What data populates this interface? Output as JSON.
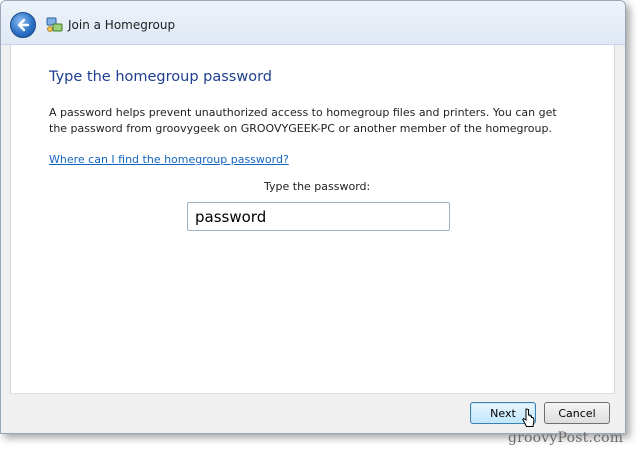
{
  "window": {
    "title": "Join a Homegroup"
  },
  "content": {
    "heading": "Type the homegroup password",
    "description": "A password helps prevent unauthorized access to homegroup files and printers. You can get the password from groovygeek on GROOVYGEEK-PC or another member of the homegroup.",
    "help_link": "Where can I find the homegroup password?",
    "password_label": "Type the password:",
    "password_value": "password"
  },
  "footer": {
    "next_label": "Next",
    "cancel_label": "Cancel"
  },
  "watermark": "groovyPost.com",
  "icons": {
    "back": "back-arrow-icon",
    "homegroup": "homegroup-icon",
    "cursor": "mouse-pointer-icon"
  },
  "colors": {
    "heading": "#1e3e8f",
    "link": "#1565c0",
    "accent_button_border": "#3c7fb1"
  }
}
